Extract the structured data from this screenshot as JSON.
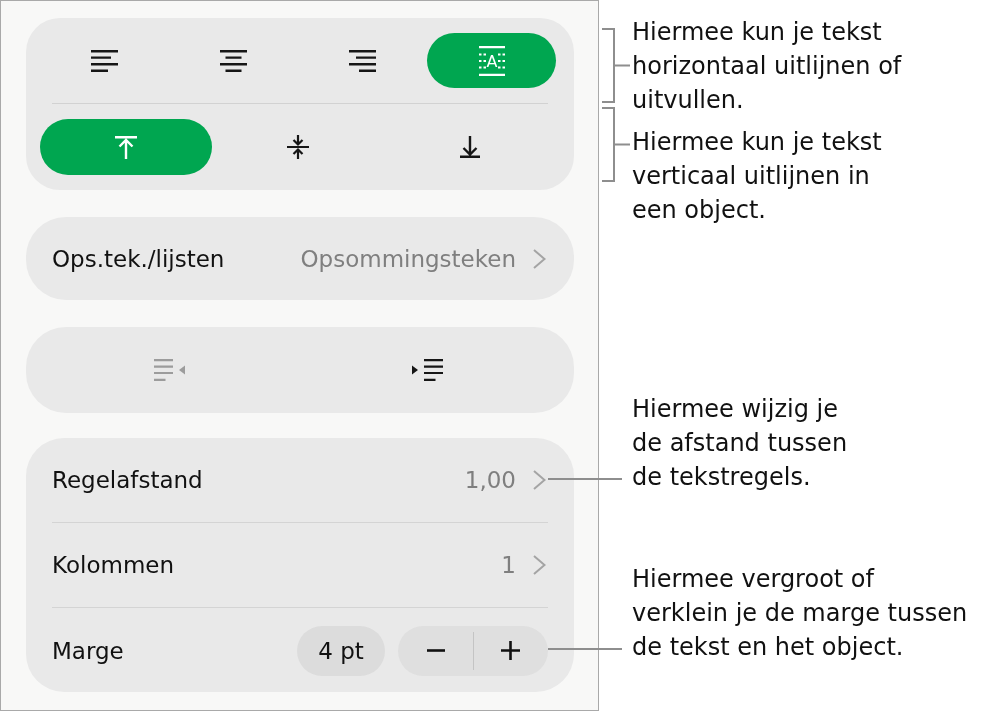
{
  "format_panel": {
    "horizontal_alignment": [
      {
        "kind": "left",
        "selected": false
      },
      {
        "kind": "center",
        "selected": false
      },
      {
        "kind": "right",
        "selected": false
      },
      {
        "kind": "justify",
        "selected": true,
        "glyph": "A"
      }
    ],
    "vertical_alignment": [
      {
        "kind": "top",
        "selected": true
      },
      {
        "kind": "middle",
        "selected": false
      },
      {
        "kind": "bottom",
        "selected": false
      }
    ],
    "bullets_row": {
      "label": "Ops.tek./lijsten",
      "value": "Opsommingsteken"
    },
    "indent_buttons": [
      {
        "kind": "decrease",
        "disabled": true
      },
      {
        "kind": "increase",
        "disabled": false
      }
    ],
    "layout_rows": [
      {
        "kind": "link",
        "label": "Regelafstand",
        "value": "1,00"
      },
      {
        "kind": "link",
        "label": "Kolommen",
        "value": "1"
      },
      {
        "kind": "stepper",
        "label": "Marge",
        "value": "4 pt"
      }
    ]
  },
  "callouts": [
    {
      "kind": "bracket",
      "text": "Hiermee kun je tekst\nhorizontaal uitlijnen of\nuitvullen."
    },
    {
      "kind": "bracket",
      "text": "Hiermee kun je tekst\nverticaal uitlijnen in\neen object."
    },
    {
      "kind": "leader",
      "text": "Hiermee wijzig je\nde afstand tussen\nde tekstregels."
    },
    {
      "kind": "leader",
      "text": "Hiermee vergroot of\nverklein je de marge tussen\nde tekst en het object."
    }
  ]
}
